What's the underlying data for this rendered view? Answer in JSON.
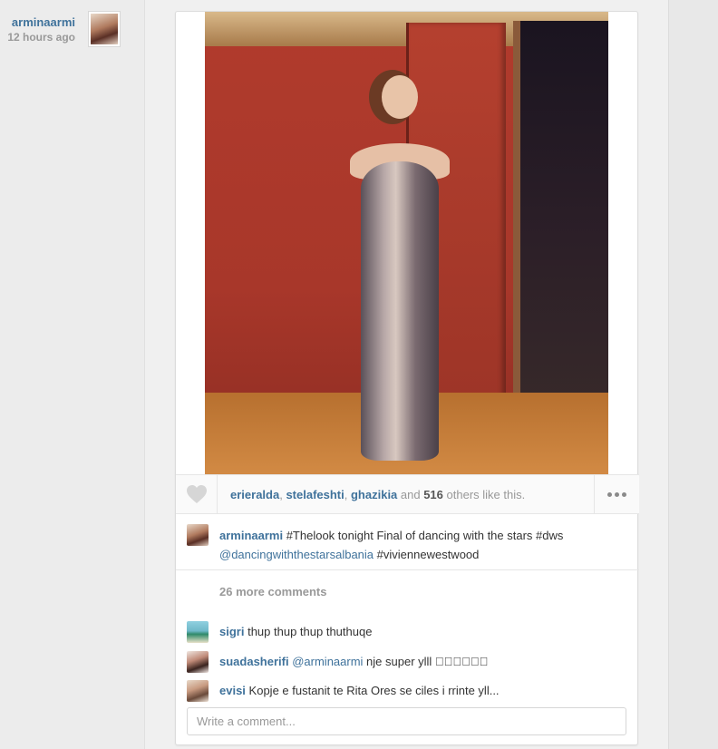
{
  "post": {
    "author": {
      "username": "arminaarmi",
      "time_ago": "12 hours ago"
    },
    "likes": {
      "likers": [
        "erieralda",
        "stelafeshti",
        "ghazikia"
      ],
      "sep1": ", ",
      "sep2": ", ",
      "and_text": " and ",
      "count": "516",
      "suffix": " others like this."
    },
    "caption": {
      "username": "arminaarmi",
      "text_part1": " #Thelook tonight Final of dancing with the stars #dws",
      "mention": "@dancingwiththestarsalbania",
      "text_part2": " #viviennewestwood"
    },
    "comments": {
      "more_label": "26 more comments",
      "items": [
        {
          "username": "sigri",
          "text": "thup thup thup thuthuqe"
        },
        {
          "username": "suadasherifi",
          "mention": "@arminaarmi",
          "text": " nje super ylll 󾬏󾬏󾬏󾬏󾬏󾬐"
        },
        {
          "username": "evisi",
          "text": "Kopje e fustanit te Rita Ores se ciles i rrinte yll..."
        }
      ]
    },
    "comment_input": {
      "placeholder": "Write a comment..."
    }
  },
  "icons": {
    "like": "heart-icon",
    "more": "more-options-icon"
  },
  "colors": {
    "username": "#3f729b",
    "muted": "#999999",
    "background": "#f0f0f0"
  }
}
